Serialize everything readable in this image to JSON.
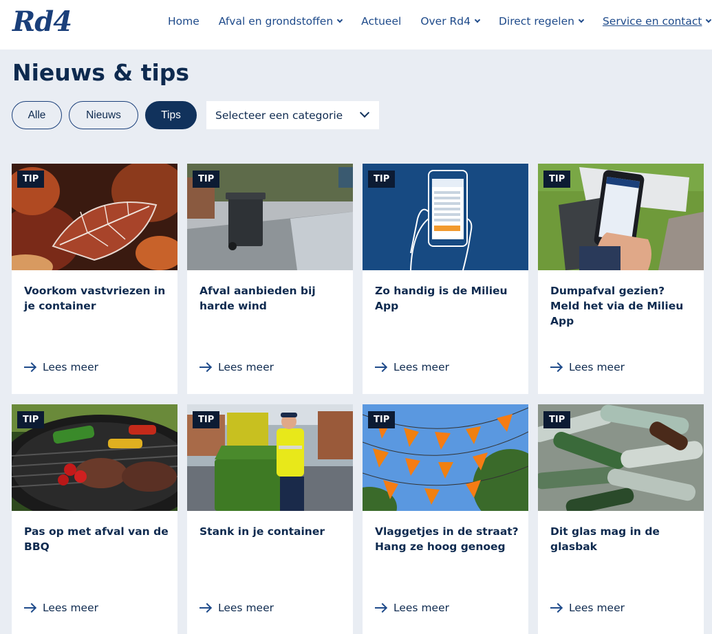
{
  "header": {
    "logo": "Rd4",
    "nav": [
      {
        "label": "Home",
        "has_dropdown": false
      },
      {
        "label": "Afval en grondstoffen",
        "has_dropdown": true
      },
      {
        "label": "Actueel",
        "has_dropdown": false
      },
      {
        "label": "Over Rd4",
        "has_dropdown": true
      },
      {
        "label": "Direct regelen",
        "has_dropdown": true
      },
      {
        "label": "Service en contact",
        "has_dropdown": true
      }
    ]
  },
  "page": {
    "title": "Nieuws & tips"
  },
  "filters": {
    "all": "Alle",
    "news": "Nieuws",
    "tips": "Tips",
    "active": "Tips",
    "category_select": "Selecteer een categorie"
  },
  "cards": [
    {
      "badge": "TIP",
      "title": "Voorkom vastvriezen in je container",
      "link": "Lees meer",
      "image": "frosted-leaf"
    },
    {
      "badge": "TIP",
      "title": "Afval aanbieden bij harde wind",
      "link": "Lees meer",
      "image": "bin-on-street"
    },
    {
      "badge": "TIP",
      "title": "Zo handig is de Milieu App",
      "link": "Lees meer",
      "image": "phone-app-illustration"
    },
    {
      "badge": "TIP",
      "title": "Dumpafval gezien? Meld het via de Milieu App",
      "link": "Lees meer",
      "image": "phone-dumped-waste"
    },
    {
      "badge": "TIP",
      "title": "Pas op met afval van de BBQ",
      "link": "Lees meer",
      "image": "bbq-grill"
    },
    {
      "badge": "TIP",
      "title": "Stank in je container",
      "link": "Lees meer",
      "image": "waste-collector"
    },
    {
      "badge": "TIP",
      "title": "Vlaggetjes in de straat? Hang ze hoog genoeg",
      "link": "Lees meer",
      "image": "orange-bunting"
    },
    {
      "badge": "TIP",
      "title": "Dit glas mag in de glasbak",
      "link": "Lees meer",
      "image": "glass-bottles"
    }
  ],
  "colors": {
    "page_bg": "#e9edf3",
    "brand_dark": "#11325c",
    "brand_link": "#1e4a8a",
    "badge_bg": "#0c1b33"
  }
}
